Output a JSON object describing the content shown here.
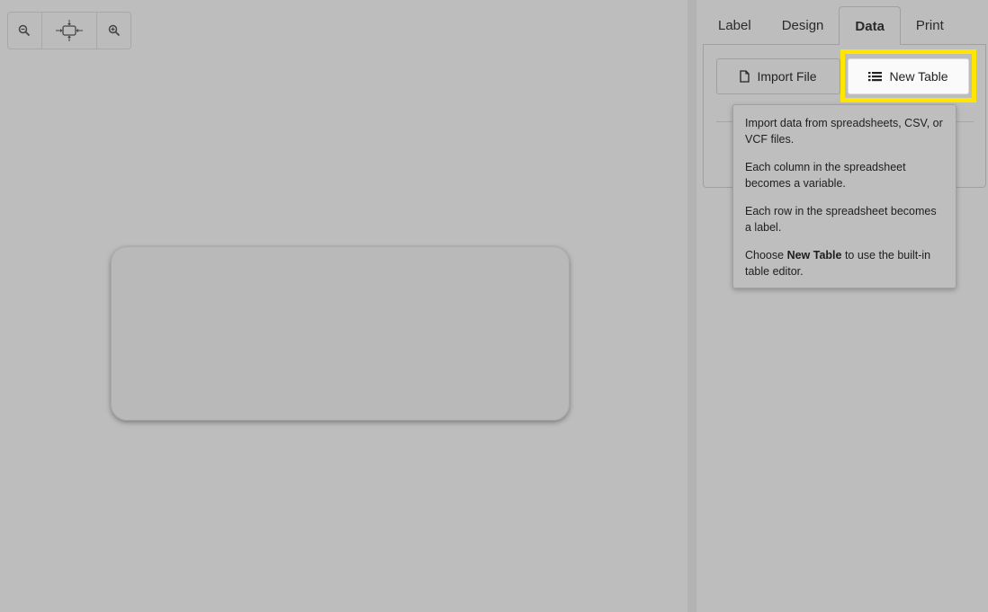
{
  "tabs": [
    {
      "label": "Label"
    },
    {
      "label": "Design"
    },
    {
      "label": "Data"
    },
    {
      "label": "Print"
    }
  ],
  "active_tab": "Data",
  "data_panel": {
    "import_button_label": "Import File",
    "new_table_button_label": "New Table"
  },
  "tooltip": {
    "p1": "Import data from spreadsheets, CSV, or VCF files.",
    "p2": "Each column in the spreadsheet becomes a variable.",
    "p3": "Each row in the spreadsheet becomes a label.",
    "p4_prefix": "Choose ",
    "p4_bold": "New Table",
    "p4_suffix": " to use the built-in table editor."
  },
  "icons": {
    "zoom_out": "zoom-out-icon",
    "fit": "fit-to-window-icon",
    "zoom_in": "zoom-in-icon",
    "file": "file-icon",
    "list": "list-icon"
  },
  "colors": {
    "highlight": "#ffe600",
    "background": "#bdbdbd"
  }
}
